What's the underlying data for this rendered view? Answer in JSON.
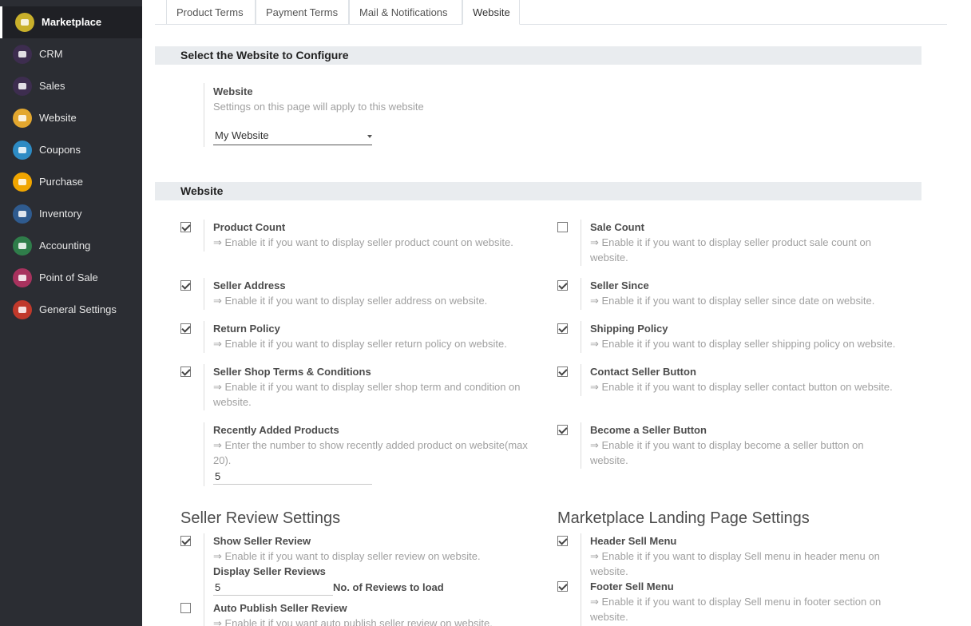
{
  "sidebar": {
    "items": [
      {
        "label": "Marketplace",
        "icon": "marketplace-icon",
        "color": "#c9b02b"
      },
      {
        "label": "CRM",
        "icon": "crm-icon",
        "color": "#3d2d4f"
      },
      {
        "label": "Sales",
        "icon": "sales-icon",
        "color": "#3d2d4f"
      },
      {
        "label": "Website",
        "icon": "website-icon",
        "color": "#e3a72f"
      },
      {
        "label": "Coupons",
        "icon": "coupons-icon",
        "color": "#2d8bc4"
      },
      {
        "label": "Purchase",
        "icon": "purchase-icon",
        "color": "#f0a500"
      },
      {
        "label": "Inventory",
        "icon": "inventory-icon",
        "color": "#2f5b8f"
      },
      {
        "label": "Accounting",
        "icon": "accounting-icon",
        "color": "#2f7d4a"
      },
      {
        "label": "Point of Sale",
        "icon": "point-of-sale-icon",
        "color": "#a8325e"
      },
      {
        "label": "General Settings",
        "icon": "general-settings-icon",
        "color": "#c0392b"
      }
    ]
  },
  "tabs": [
    {
      "label": "Product Terms"
    },
    {
      "label": "Payment Terms"
    },
    {
      "label": "Mail & Notifications"
    },
    {
      "label": "Website"
    }
  ],
  "website_select": {
    "section_title": "Select the Website to Configure",
    "label": "Website",
    "desc": "Settings on this page will apply to this website",
    "value": "My Website"
  },
  "website_section": {
    "title": "Website",
    "product_count": {
      "label": "Product Count",
      "desc": "⇒ Enable it if you want to display seller product count on website.",
      "checked": true
    },
    "sale_count": {
      "label": "Sale Count",
      "desc1": "⇒ Enable it if you want to display seller product sale count on",
      "desc2": "website.",
      "checked": false
    },
    "seller_address": {
      "label": "Seller Address",
      "desc": "⇒ Enable it if you want to display seller address on website.",
      "checked": true
    },
    "seller_since": {
      "label": "Seller Since",
      "desc": "⇒ Enable it if you want to display seller since date on website.",
      "checked": true
    },
    "return_policy": {
      "label": "Return Policy",
      "desc": "⇒ Enable it if you want to display seller return policy on website.",
      "checked": true
    },
    "shipping_policy": {
      "label": "Shipping Policy",
      "desc": "⇒ Enable it if you want to display seller shipping policy on website.",
      "checked": true
    },
    "shop_terms": {
      "label": "Seller Shop Terms & Conditions",
      "desc1": "⇒ Enable it if you want to display seller shop term and condition on",
      "desc2": "website.",
      "checked": true
    },
    "contact_button": {
      "label": "Contact Seller Button",
      "desc": "⇒ Enable it if you want to display seller contact button on website.",
      "checked": true
    },
    "recent_products": {
      "label": "Recently Added Products",
      "desc1": "⇒ Enter the number to show recently added product on website(max",
      "desc2": "20).",
      "value": "5"
    },
    "become_seller": {
      "label": "Become a Seller Button",
      "desc1": "⇒ Enable it if you want to display become a seller button on",
      "desc2": "website.",
      "checked": true
    }
  },
  "review_settings": {
    "title": "Seller Review Settings",
    "show_review": {
      "label": "Show Seller Review",
      "desc": "⇒ Enable it if you want to display seller review on website.",
      "checked": true
    },
    "display_reviews": {
      "label": "Display Seller Reviews",
      "value": "5",
      "suffix": "No. of Reviews to load"
    },
    "auto_publish": {
      "label": "Auto Publish Seller Review",
      "desc": "⇒ Enable it if you want auto publish seller review on website.",
      "checked": false
    }
  },
  "landing_settings": {
    "title": "Marketplace Landing Page Settings",
    "header_sell": {
      "label": "Header Sell Menu",
      "desc1": "⇒ Enable it if you want to display Sell menu in header menu on",
      "desc2": "website.",
      "checked": true
    },
    "footer_sell": {
      "label": "Footer Sell Menu",
      "desc1": "⇒ Enable it if you want to display Sell menu in footer section on",
      "desc2": "website.",
      "checked": true
    }
  }
}
